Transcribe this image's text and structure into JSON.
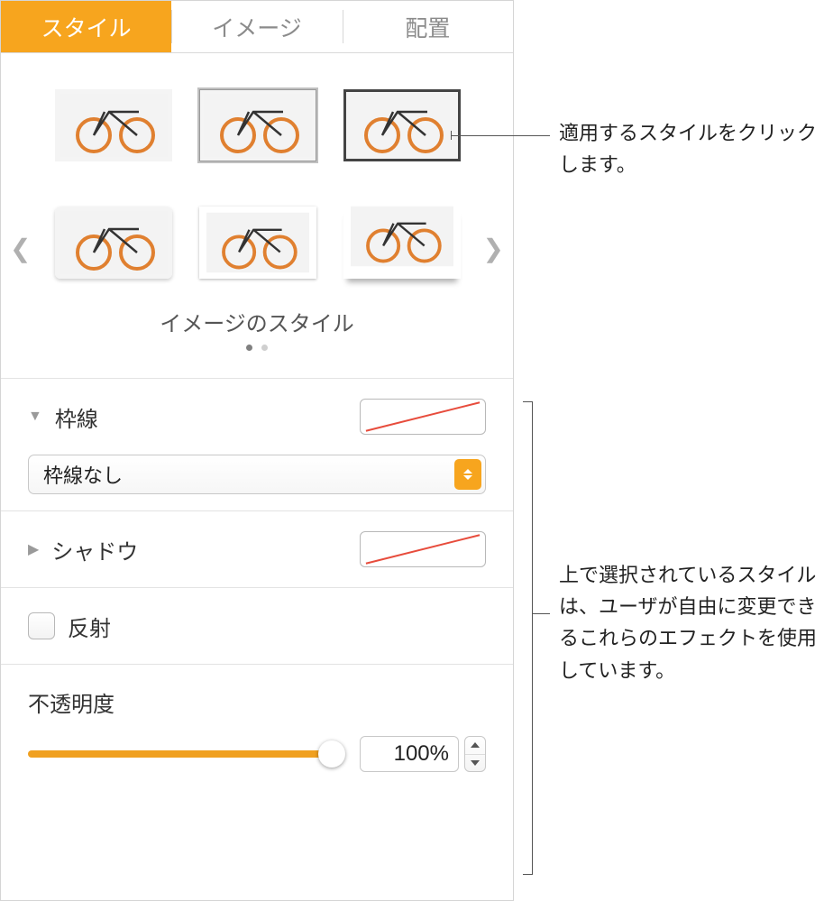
{
  "tabs": {
    "style": "スタイル",
    "image": "イメージ",
    "arrange": "配置"
  },
  "styles": {
    "section_label": "イメージのスタイル"
  },
  "border": {
    "label": "枠線",
    "select_value": "枠線なし"
  },
  "shadow": {
    "label": "シャドウ"
  },
  "reflection": {
    "label": "反射"
  },
  "opacity": {
    "label": "不透明度",
    "value": "100%"
  },
  "callouts": {
    "c1": "適用するスタイルをクリックします。",
    "c2": "上で選択されているスタイルは、ユーザが自由に変更できるこれらのエフェクトを使用しています。"
  }
}
